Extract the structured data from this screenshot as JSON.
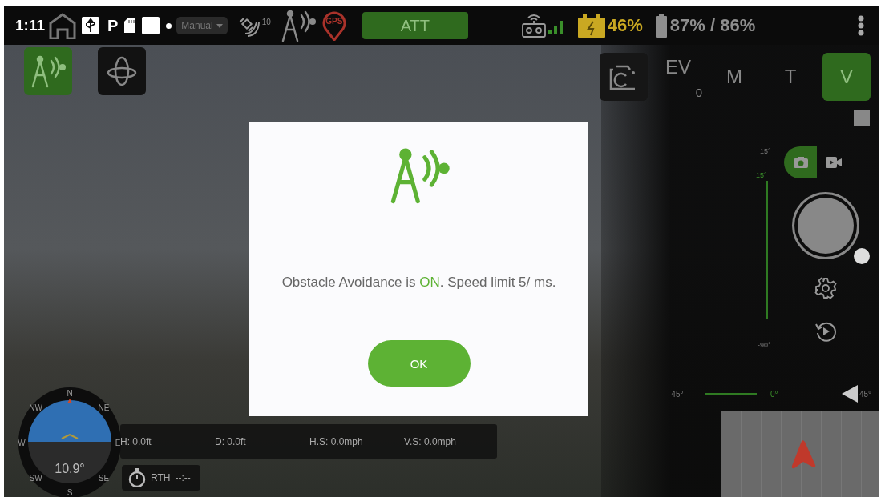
{
  "status_bar": {
    "time": "1:11",
    "mode_letter": "P",
    "flight_mode": "Manual",
    "satellite_count": "10",
    "gps_label": "GPS",
    "attitude_mode": "ATT",
    "controller_battery": "46%",
    "aircraft_battery": "87% / 86%"
  },
  "left_buttons": [
    {
      "kind": "obstacle",
      "selected": true
    },
    {
      "kind": "gimbal",
      "selected": false
    }
  ],
  "camera_bar": {
    "ev_label": "EV",
    "ev_value": "0",
    "modes": [
      {
        "label": "M",
        "selected": false
      },
      {
        "label": "T",
        "selected": false
      },
      {
        "label": "V",
        "selected": true
      }
    ]
  },
  "capture_modes": [
    {
      "kind": "photo",
      "selected": true
    },
    {
      "kind": "video",
      "selected": false
    }
  ],
  "gimbal_pitch": {
    "top_label": "15°",
    "current_label": "15°",
    "bottom_label": "-90°"
  },
  "gimbal_yaw": {
    "left_label": "-45°",
    "center_label": "0°",
    "right_label": "45°"
  },
  "telemetry": [
    "H: 0.0ft",
    "D: 0.0ft",
    "H.S: 0.0mph",
    "V.S: 0.0mph"
  ],
  "rth": {
    "label": "RTH",
    "time": "--:--"
  },
  "compass": {
    "heading": "10.9°",
    "labels": [
      "N",
      "NE",
      "E",
      "SE",
      "S",
      "SW",
      "W",
      "NW"
    ]
  },
  "dialog": {
    "message": "Obstacle Avoidance is **ON**. Speed limit 5/ ms.",
    "button": "OK"
  }
}
